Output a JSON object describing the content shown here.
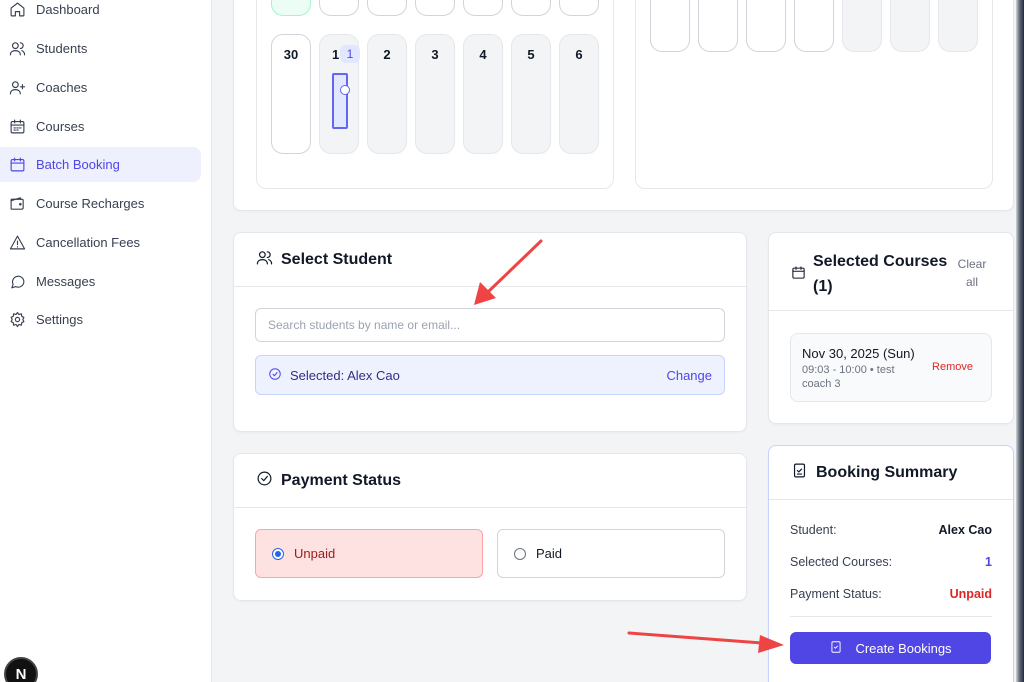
{
  "sidebar": {
    "items": [
      {
        "label": "Dashboard",
        "icon": "home-icon",
        "active": false
      },
      {
        "label": "Students",
        "icon": "users-icon",
        "active": false
      },
      {
        "label": "Coaches",
        "icon": "user-plus-icon",
        "active": false
      },
      {
        "label": "Courses",
        "icon": "calendar-icon",
        "active": false
      },
      {
        "label": "Batch Booking",
        "icon": "calendar-icon",
        "active": true
      },
      {
        "label": "Course Recharges",
        "icon": "wallet-icon",
        "active": false
      },
      {
        "label": "Cancellation Fees",
        "icon": "warning-icon",
        "active": false
      },
      {
        "label": "Messages",
        "icon": "message-icon",
        "active": false
      },
      {
        "label": "Settings",
        "icon": "gear-icon",
        "active": false
      }
    ],
    "badge_letter": "N"
  },
  "calendar": {
    "week_days": [
      "30",
      "1",
      "2",
      "3",
      "4",
      "5",
      "6"
    ],
    "day1_count": "1"
  },
  "select_student": {
    "title": "Select Student",
    "search_placeholder": "Search students by name or email...",
    "selected_text": "Selected: Alex Cao",
    "change_label": "Change"
  },
  "payment_status": {
    "title": "Payment Status",
    "options": [
      {
        "label": "Unpaid",
        "selected": true
      },
      {
        "label": "Paid",
        "selected": false
      }
    ]
  },
  "selected_courses": {
    "title": "Selected Courses",
    "count_text": "(1)",
    "clear_label": "Clear all",
    "items": [
      {
        "date": "Nov 30, 2025 (Sun)",
        "detail": "09:03 - 10:00 • test coach 3",
        "remove_label": "Remove"
      }
    ]
  },
  "booking_summary": {
    "title": "Booking Summary",
    "rows": [
      {
        "label": "Student:",
        "value": "Alex Cao",
        "color": "#111827"
      },
      {
        "label": "Selected Courses:",
        "value": "1",
        "color": "#4f46e5"
      },
      {
        "label": "Payment Status:",
        "value": "Unpaid",
        "color": "#dc2626"
      }
    ],
    "create_label": "Create Bookings"
  },
  "colors": {
    "accent": "#4f46e5",
    "danger": "#dc2626",
    "annotation_arrow": "#ef4444"
  }
}
